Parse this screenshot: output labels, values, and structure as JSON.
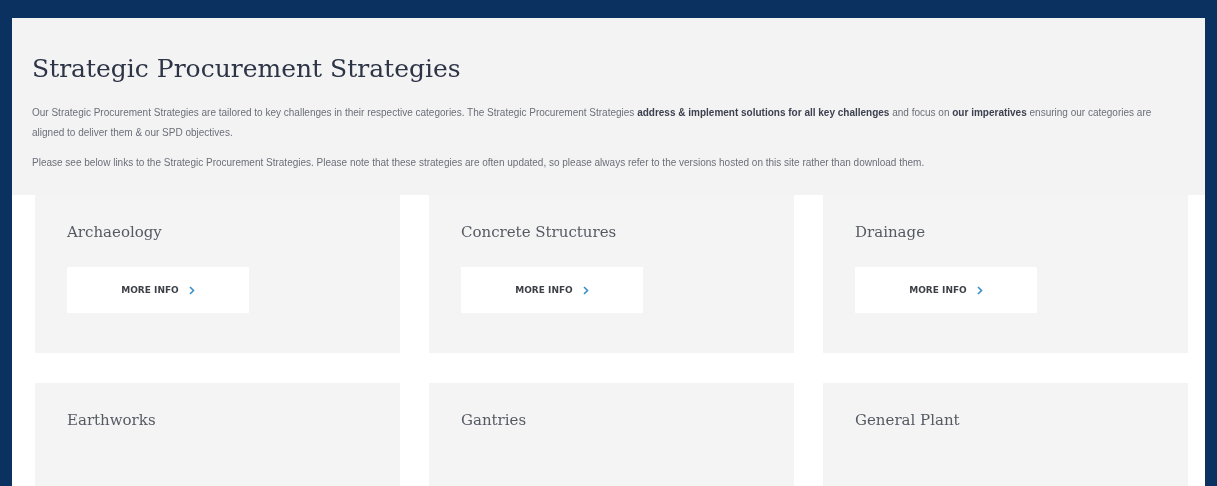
{
  "page": {
    "title": "Strategic Procurement Strategies",
    "paragraphs": [
      "Our Strategic Procurement Strategies are tailored to key challenges in their respective categories.  The Strategic Procurement Strategies **address & implement solutions for all key challenges** and focus on **our imperatives** ensuring our categories are aligned to deliver them & our SPD objectives.",
      "Please see below links to the Strategic Procurement Strategies.  Please note that these strategies are often updated, so please always refer to the versions hosted on this site rather than download them."
    ]
  },
  "cards": [
    {
      "title": "Archaeology",
      "button": "MORE INFO"
    },
    {
      "title": "Concrete Structures",
      "button": "MORE INFO"
    },
    {
      "title": "Drainage",
      "button": "MORE INFO"
    },
    {
      "title": "Earthworks"
    },
    {
      "title": "Gantries"
    },
    {
      "title": "General Plant"
    }
  ]
}
